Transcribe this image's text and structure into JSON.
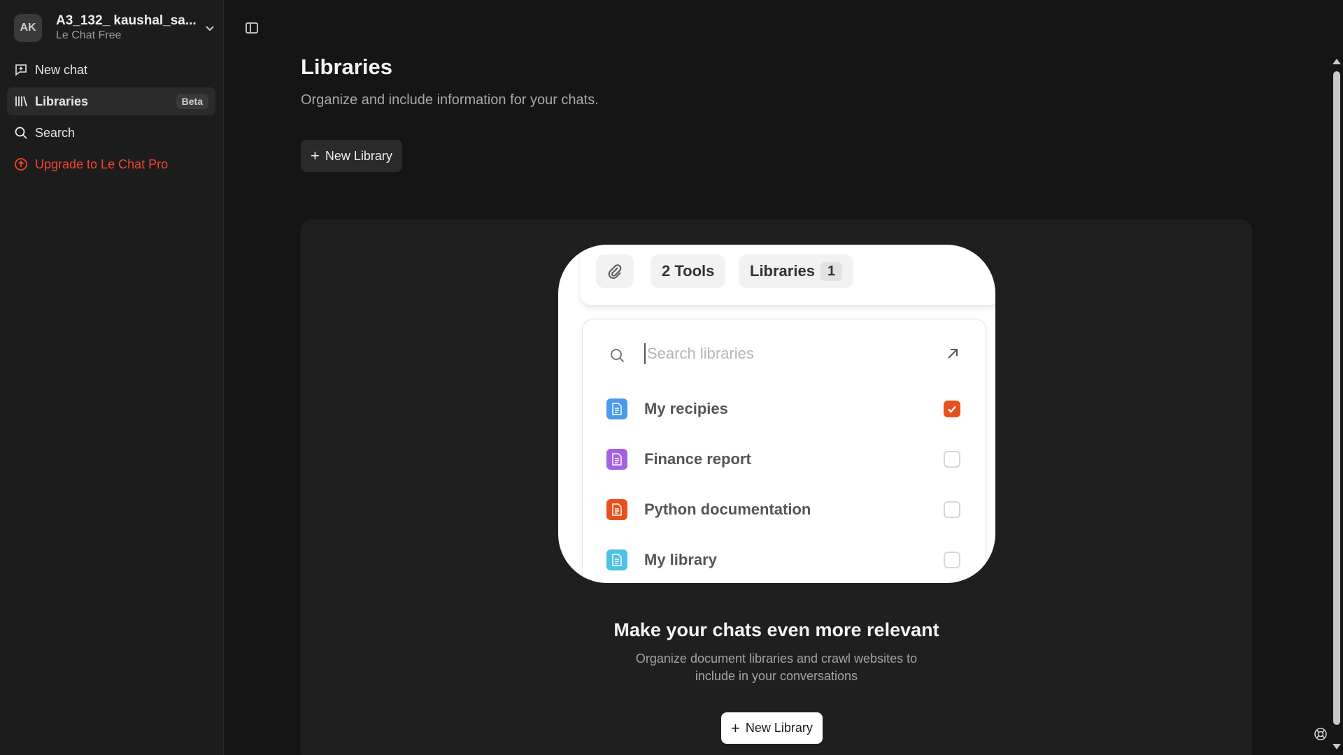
{
  "sidebar": {
    "account": {
      "initials": "AK",
      "name": "A3_132_ kaushal_sa...",
      "plan": "Le Chat Free"
    },
    "items": [
      {
        "label": "New chat",
        "icon": "new-chat-icon"
      },
      {
        "label": "Libraries",
        "icon": "libraries-icon",
        "badge": "Beta",
        "active": true
      },
      {
        "label": "Search",
        "icon": "search-icon"
      },
      {
        "label": "Upgrade to Le Chat Pro",
        "icon": "upgrade-icon",
        "color": "#f0452b"
      }
    ]
  },
  "main": {
    "title": "Libraries",
    "subtitle": "Organize and include information for your chats.",
    "new_library_label": "New Library"
  },
  "illustration": {
    "tools_label": "2 Tools",
    "libraries_label": "Libraries",
    "libraries_count": "1",
    "search_placeholder": "Search libraries",
    "libraries": [
      {
        "name": "My recipies",
        "color": "#4a9bef",
        "checked": true
      },
      {
        "name": "Finance report",
        "color": "#a461e0",
        "checked": false
      },
      {
        "name": "Python documentation",
        "color": "#e8501e",
        "checked": false
      },
      {
        "name": "My library",
        "color": "#4ec1e6",
        "checked": false
      }
    ]
  },
  "empty_state": {
    "title": "Make your chats even more relevant",
    "description": "Organize document libraries and crawl websites to include in your conversations",
    "button_label": "New Library"
  },
  "colors": {
    "accent": "#e8501e",
    "upgrade": "#f0452b",
    "background": "#151515"
  }
}
